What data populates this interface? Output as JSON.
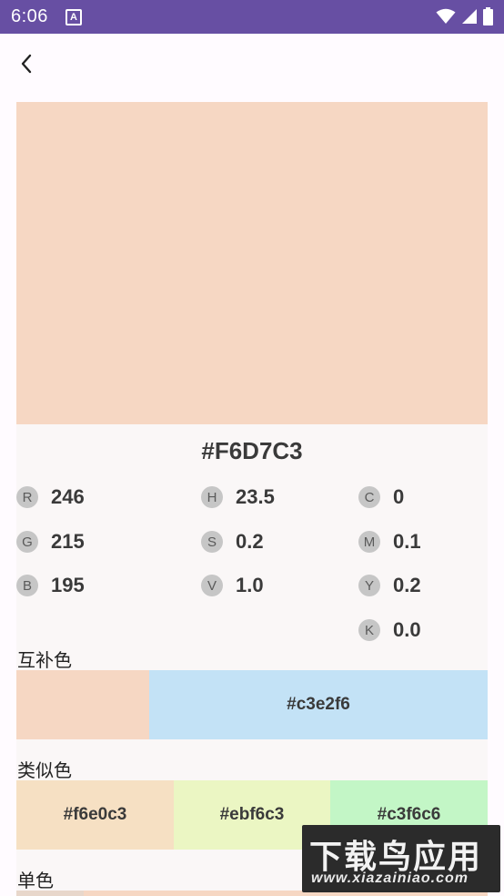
{
  "status_bar": {
    "time": "6:06",
    "notification_icon_letter": "A"
  },
  "main_color": {
    "hex": "#F6D7C3",
    "swatch_color": "#f6d7c3"
  },
  "rgb": [
    {
      "label": "R",
      "value": "246"
    },
    {
      "label": "G",
      "value": "215"
    },
    {
      "label": "B",
      "value": "195"
    }
  ],
  "hsv": [
    {
      "label": "H",
      "value": "23.5"
    },
    {
      "label": "S",
      "value": "0.2"
    },
    {
      "label": "V",
      "value": "1.0"
    }
  ],
  "cmyk": [
    {
      "label": "C",
      "value": "0"
    },
    {
      "label": "M",
      "value": "0.1"
    },
    {
      "label": "Y",
      "value": "0.2"
    },
    {
      "label": "K",
      "value": "0.0"
    }
  ],
  "complementary": {
    "title": "互补色",
    "colors": [
      {
        "hex": "",
        "color": "#f6d7c3"
      },
      {
        "hex": "#c3e2f6",
        "color": "#c3e2f6"
      }
    ]
  },
  "analogous": {
    "title": "类似色",
    "colors": [
      {
        "hex": "#f6e0c3",
        "color": "#f6e0c3"
      },
      {
        "hex": "#ebf6c3",
        "color": "#ebf6c3"
      },
      {
        "hex": "#c3f6c6",
        "color": "#c3f6c6"
      }
    ]
  },
  "monochrome": {
    "title": "单色"
  },
  "watermark": {
    "big": "下载鸟应用",
    "small": "www.xiazainiao.com"
  },
  "colors": {
    "status_bar": "#674fa3",
    "page_bg": "#fffbff",
    "card_bg": "#faf7f7",
    "chip_bg": "#c6c6c6"
  }
}
